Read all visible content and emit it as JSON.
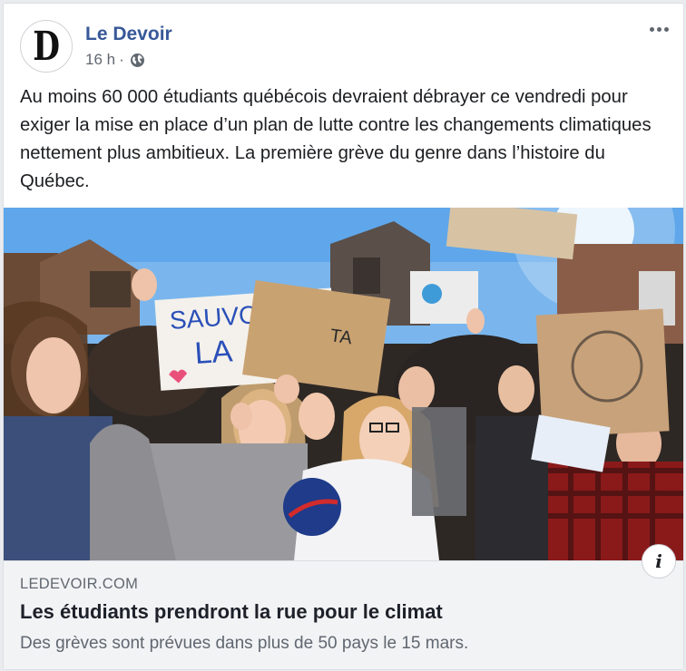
{
  "post": {
    "page_name": "Le Devoir",
    "avatar_letter": "D",
    "time": "16 h",
    "separator": "·",
    "privacy_icon": "globe-icon",
    "more_icon": "more-options-icon",
    "text": "Au moins 60 000 étudiants québécois devraient débrayer ce vendredi pour exiger la mise en place d’un plan de lutte contre les changements climatiques nettement plus ambitieux. La première grève du genre dans l’histoire du Québec."
  },
  "photo": {
    "sign_line1": "SAUVONS",
    "sign_line2": "LA"
  },
  "link": {
    "domain": "LEDEVOIR.COM",
    "title": "Les étudiants prendront la rue pour le climat",
    "description": "Des grèves sont prévues dans plus de 50 pays le 15 mars.",
    "info_label": "i"
  },
  "colors": {
    "page_name": "#385898",
    "text": "#1c1e21",
    "meta": "#616770",
    "link_bg": "#f2f3f5"
  }
}
